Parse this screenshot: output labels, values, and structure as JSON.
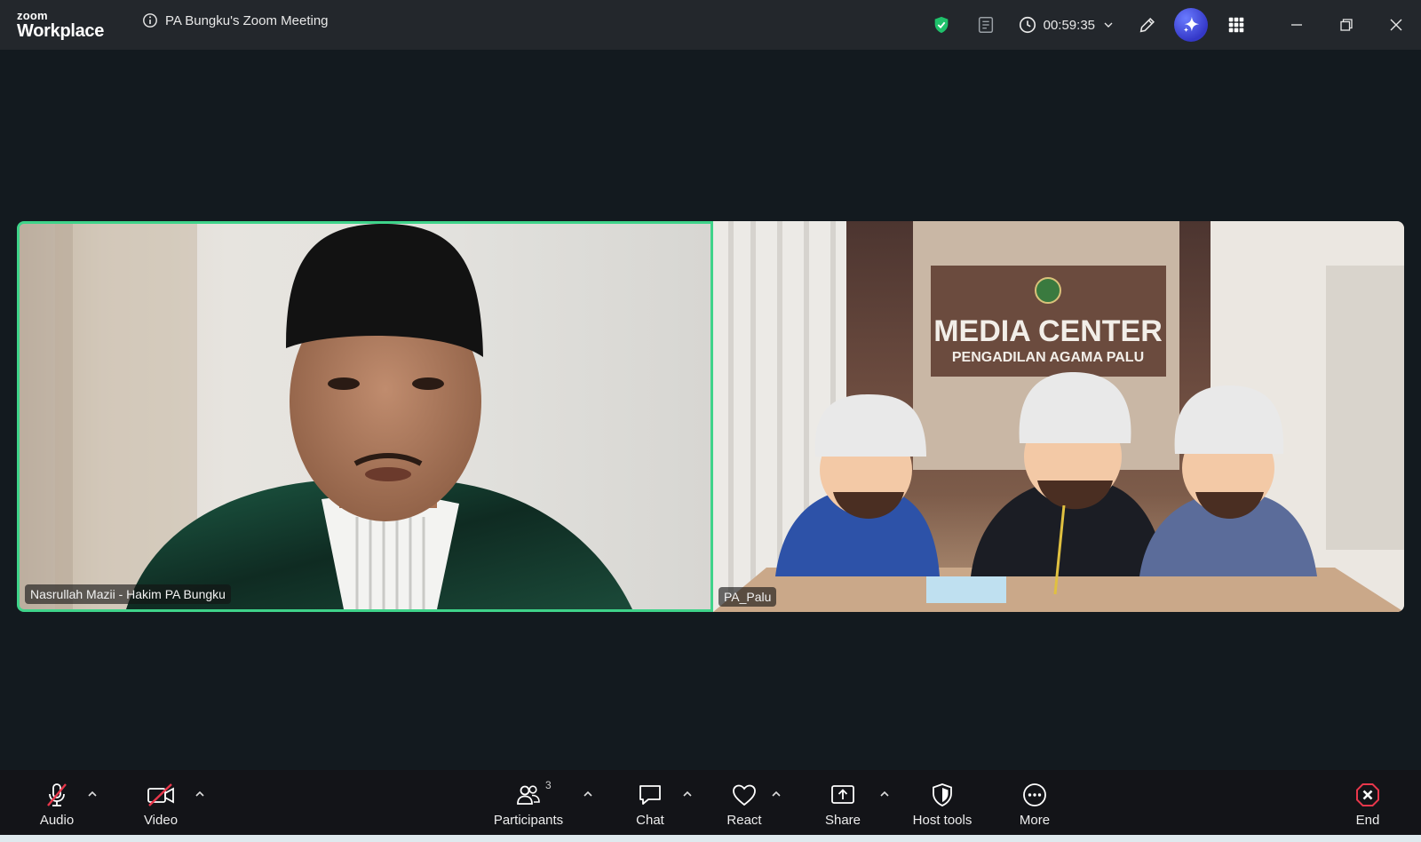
{
  "app": {
    "brand_top": "zoom",
    "brand_bottom": "Workplace"
  },
  "meeting": {
    "title": "PA Bungku's Zoom Meeting",
    "timer": "00:59:35"
  },
  "tiles": [
    {
      "name": "Nasrullah Mazii - Hakim PA Bungku"
    },
    {
      "name": "PA_Palu"
    }
  ],
  "toolbar": {
    "audio": "Audio",
    "video": "Video",
    "participants": "Participants",
    "participants_count": "3",
    "chat": "Chat",
    "react": "React",
    "share": "Share",
    "host_tools": "Host tools",
    "more": "More",
    "end": "End"
  },
  "colors": {
    "active_speaker": "#3fd38a",
    "end_red": "#e8374b",
    "muted_red": "#e8374b",
    "shield_green": "#1fc16b",
    "ai_blue": "#3a3fd0"
  }
}
